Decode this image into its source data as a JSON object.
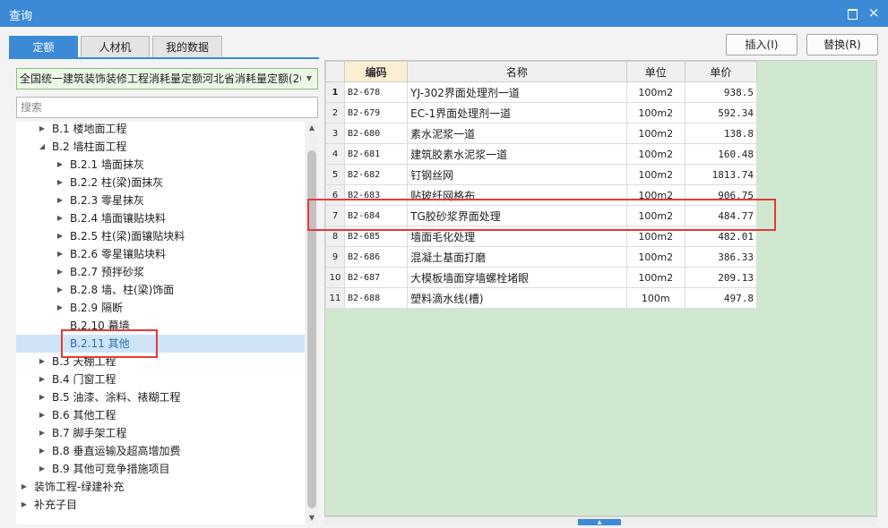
{
  "window": {
    "title": "查询",
    "close_glyph": "×"
  },
  "tabs": [
    {
      "label": "定额",
      "active": true
    },
    {
      "label": "人材机",
      "active": false
    },
    {
      "label": "我的数据",
      "active": false
    }
  ],
  "left_panel": {
    "dropdown_value": "全国统一建筑装饰装修工程消耗量定额河北省消耗量定额(20",
    "search_placeholder": "搜索",
    "tree": [
      {
        "label": "B.1 楼地面工程",
        "level": 1,
        "expanded": false
      },
      {
        "label": "B.2 墙柱面工程",
        "level": 1,
        "expanded": true
      },
      {
        "label": "B.2.1 墙面抹灰",
        "level": 2,
        "expanded": false
      },
      {
        "label": "B.2.2 柱(梁)面抹灰",
        "level": 2,
        "expanded": false
      },
      {
        "label": "B.2.3 零星抹灰",
        "level": 2,
        "expanded": false
      },
      {
        "label": "B.2.4 墙面镶贴块料",
        "level": 2,
        "expanded": false
      },
      {
        "label": "B.2.5 柱(梁)面镶贴块料",
        "level": 2,
        "expanded": false
      },
      {
        "label": "B.2.6 零星镶贴块料",
        "level": 2,
        "expanded": false
      },
      {
        "label": "B.2.7 预拌砂浆",
        "level": 2,
        "expanded": false
      },
      {
        "label": "B.2.8 墙、柱(梁)饰面",
        "level": 2,
        "expanded": false
      },
      {
        "label": "B.2.9 隔断",
        "level": 2,
        "expanded": false
      },
      {
        "label": "B.2.10 幕墙",
        "level": 2,
        "leaf": true
      },
      {
        "label": "B.2.11 其他",
        "level": 2,
        "leaf": true,
        "selected": true
      },
      {
        "label": "B.3 天棚工程",
        "level": 1,
        "expanded": false
      },
      {
        "label": "B.4 门窗工程",
        "level": 1,
        "expanded": false
      },
      {
        "label": "B.5 油漆、涂料、裱糊工程",
        "level": 1,
        "expanded": false
      },
      {
        "label": "B.6 其他工程",
        "level": 1,
        "expanded": false
      },
      {
        "label": "B.7 脚手架工程",
        "level": 1,
        "expanded": false
      },
      {
        "label": "B.8 垂直运输及超高增加费",
        "level": 1,
        "expanded": false
      },
      {
        "label": "B.9 其他可竞争措施项目",
        "level": 1,
        "expanded": false
      },
      {
        "label": "装饰工程-绿建补充",
        "level": 0,
        "expanded": false
      },
      {
        "label": "补充子目",
        "level": 0,
        "expanded": false
      }
    ]
  },
  "actions": {
    "insert_label": "插入(I)",
    "replace_label": "替换(R)"
  },
  "table": {
    "headers": {
      "code": "编码",
      "name": "名称",
      "unit": "单位",
      "price": "单价"
    },
    "current_row": 1,
    "rows": [
      {
        "idx": "1",
        "code": "B2-678",
        "name": "YJ-302界面处理剂一道",
        "unit": "100m2",
        "price": "938.5"
      },
      {
        "idx": "2",
        "code": "B2-679",
        "name": "EC-1界面处理剂一道",
        "unit": "100m2",
        "price": "592.34"
      },
      {
        "idx": "3",
        "code": "B2-680",
        "name": "素水泥浆一道",
        "unit": "100m2",
        "price": "138.8"
      },
      {
        "idx": "4",
        "code": "B2-681",
        "name": "建筑胶素水泥浆一道",
        "unit": "100m2",
        "price": "160.48"
      },
      {
        "idx": "5",
        "code": "B2-682",
        "name": "钉钢丝网",
        "unit": "100m2",
        "price": "1813.74"
      },
      {
        "idx": "6",
        "code": "B2-683",
        "name": "贴玻纤网格布",
        "unit": "100m2",
        "price": "906.75"
      },
      {
        "idx": "7",
        "code": "B2-684",
        "name": "TG胶砂浆界面处理",
        "unit": "100m2",
        "price": "484.77"
      },
      {
        "idx": "8",
        "code": "B2-685",
        "name": "墙面毛化处理",
        "unit": "100m2",
        "price": "482.01"
      },
      {
        "idx": "9",
        "code": "B2-686",
        "name": "混凝土基面打磨",
        "unit": "100m2",
        "price": "386.33"
      },
      {
        "idx": "10",
        "code": "B2-687",
        "name": "大模板墙面穿墙螺栓堵眼",
        "unit": "100m2",
        "price": "209.13"
      },
      {
        "idx": "11",
        "code": "B2-688",
        "name": "塑料滴水线(槽)",
        "unit": "100m",
        "price": "497.8"
      }
    ]
  },
  "colors": {
    "accent": "#3c8ad6",
    "highlight": "#e53935",
    "grid_bg": "#cfe8cf",
    "selection": "#cfe4f7"
  }
}
